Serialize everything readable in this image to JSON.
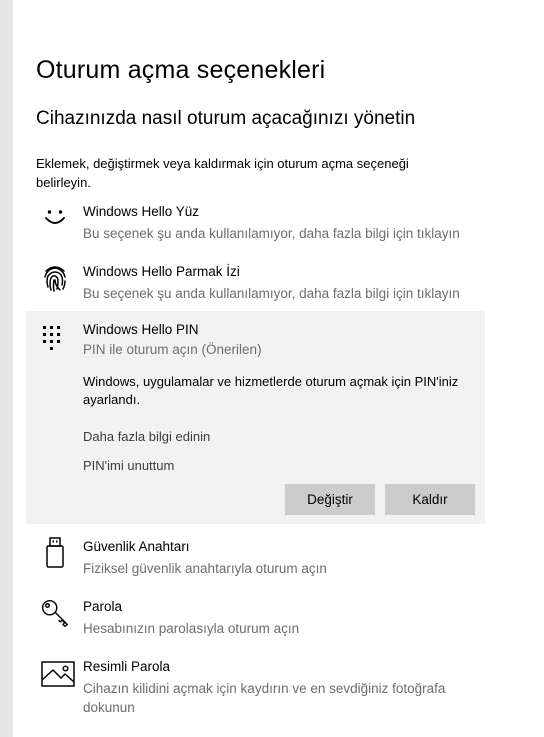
{
  "page": {
    "title": "Oturum açma seçenekleri",
    "subtitle": "Cihazınızda nasıl oturum açacağınızı yönetin",
    "description": "Eklemek, değiştirmek veya kaldırmak için oturum açma seçeneği belirleyin."
  },
  "options": [
    {
      "icon": "face-smile-icon",
      "title": "Windows Hello Yüz",
      "subtitle": "Bu seçenek şu anda kullanılamıyor, daha fazla bilgi için tıklayın"
    },
    {
      "icon": "fingerprint-icon",
      "title": "Windows Hello Parmak İzi",
      "subtitle": "Bu seçenek şu anda kullanılamıyor, daha fazla bilgi için tıklayın"
    },
    {
      "icon": "pin-keypad-icon",
      "title": "Windows Hello PIN",
      "subtitle": "PIN ile oturum açın (Önerilen)",
      "expanded": true,
      "body": "Windows, uygulamalar ve hizmetlerde oturum açmak için PIN'iniz ayarlandı.",
      "links": [
        "Daha fazla bilgi edinin",
        "PIN'imi unuttum"
      ],
      "buttons": {
        "change": "Değiştir",
        "remove": "Kaldır"
      }
    },
    {
      "icon": "usb-key-icon",
      "title": "Güvenlik Anahtarı",
      "subtitle": "Fiziksel güvenlik anahtarıyla oturum açın"
    },
    {
      "icon": "key-icon",
      "title": "Parola",
      "subtitle": "Hesabınızın parolasıyla oturum açın"
    },
    {
      "icon": "picture-icon",
      "title": "Resimli Parola",
      "subtitle": "Cihazın kilidini açmak için kaydırın ve en sevdiğiniz fotoğrafa dokunun"
    }
  ]
}
